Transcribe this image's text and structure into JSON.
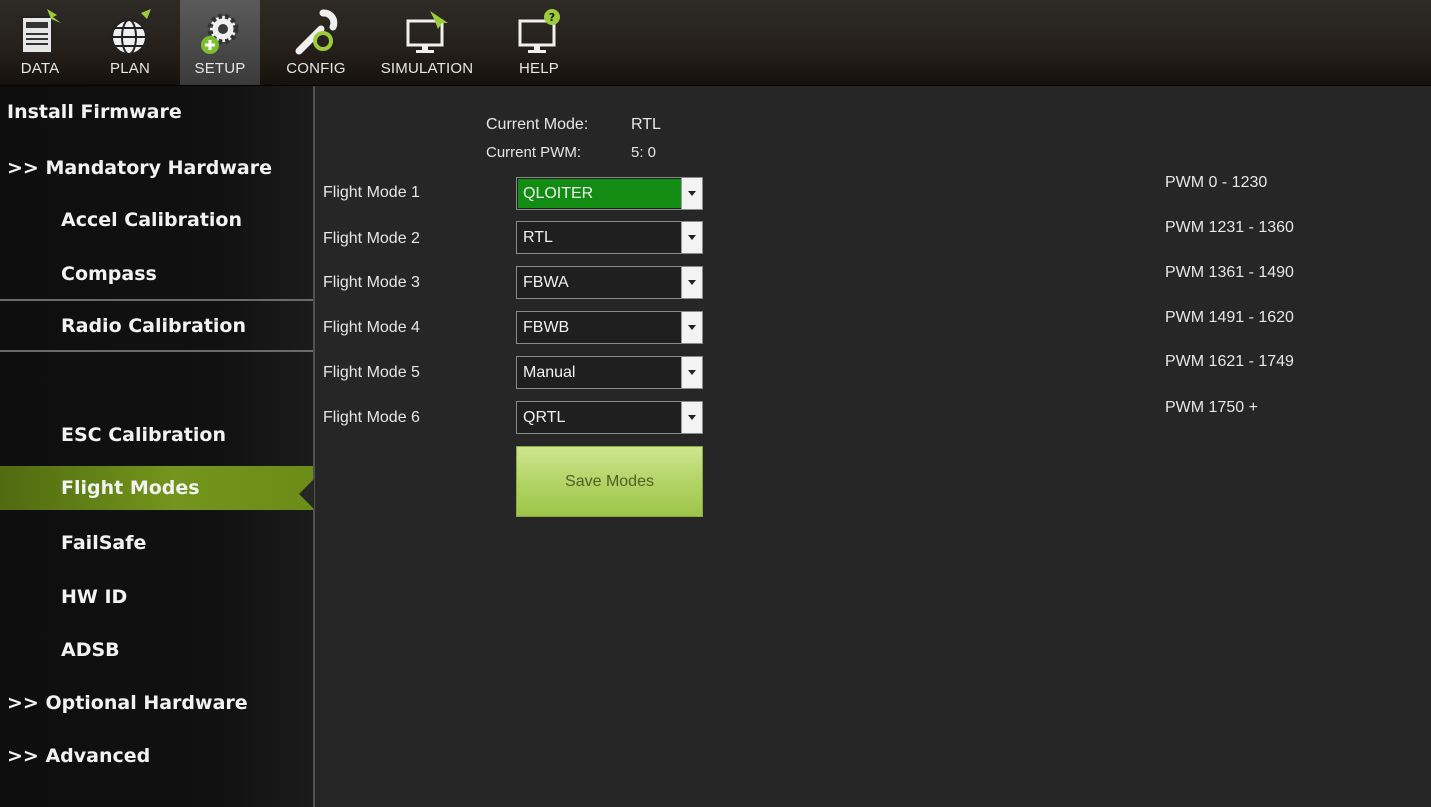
{
  "toolbar": {
    "buttons": [
      {
        "label": "DATA",
        "icon": "data-icon"
      },
      {
        "label": "PLAN",
        "icon": "globe-icon"
      },
      {
        "label": "SETUP",
        "icon": "gears-icon",
        "active": true
      },
      {
        "label": "CONFIG",
        "icon": "wrench-icon"
      },
      {
        "label": "SIMULATION",
        "icon": "monitor-plane-icon"
      },
      {
        "label": "HELP",
        "icon": "monitor-help-icon"
      }
    ]
  },
  "sidebar": {
    "items": [
      {
        "label": "Install Firmware"
      },
      {
        "label": ">> Mandatory Hardware"
      },
      {
        "label": "Accel Calibration"
      },
      {
        "label": "Compass"
      },
      {
        "label": "Radio Calibration"
      },
      {
        "label": "ESC Calibration"
      },
      {
        "label": "Flight Modes",
        "active": true
      },
      {
        "label": "FailSafe"
      },
      {
        "label": "HW ID"
      },
      {
        "label": "ADSB"
      },
      {
        "label": ">> Optional Hardware"
      },
      {
        "label": ">> Advanced"
      }
    ]
  },
  "status": {
    "current_mode_label": "Current Mode:",
    "current_mode_value": "RTL",
    "current_pwm_label": "Current PWM:",
    "current_pwm_value": "5: 0"
  },
  "modes": [
    {
      "label": "Flight Mode 1",
      "value": "QLOITER",
      "pwm": "PWM 0 - 1230"
    },
    {
      "label": "Flight Mode 2",
      "value": "RTL",
      "pwm": "PWM 1231 - 1360"
    },
    {
      "label": "Flight Mode 3",
      "value": "FBWA",
      "pwm": "PWM 1361 - 1490"
    },
    {
      "label": "Flight Mode 4",
      "value": "FBWB",
      "pwm": "PWM 1491 - 1620"
    },
    {
      "label": "Flight Mode 5",
      "value": "Manual",
      "pwm": "PWM 1621 - 1749"
    },
    {
      "label": "Flight Mode 6",
      "value": "QRTL",
      "pwm": "PWM 1750 +"
    }
  ],
  "save_button": {
    "label": "Save Modes"
  },
  "colors": {
    "accent_green": "#73951c",
    "selected_combo": "#138c13",
    "save_button": "#b3d467"
  }
}
